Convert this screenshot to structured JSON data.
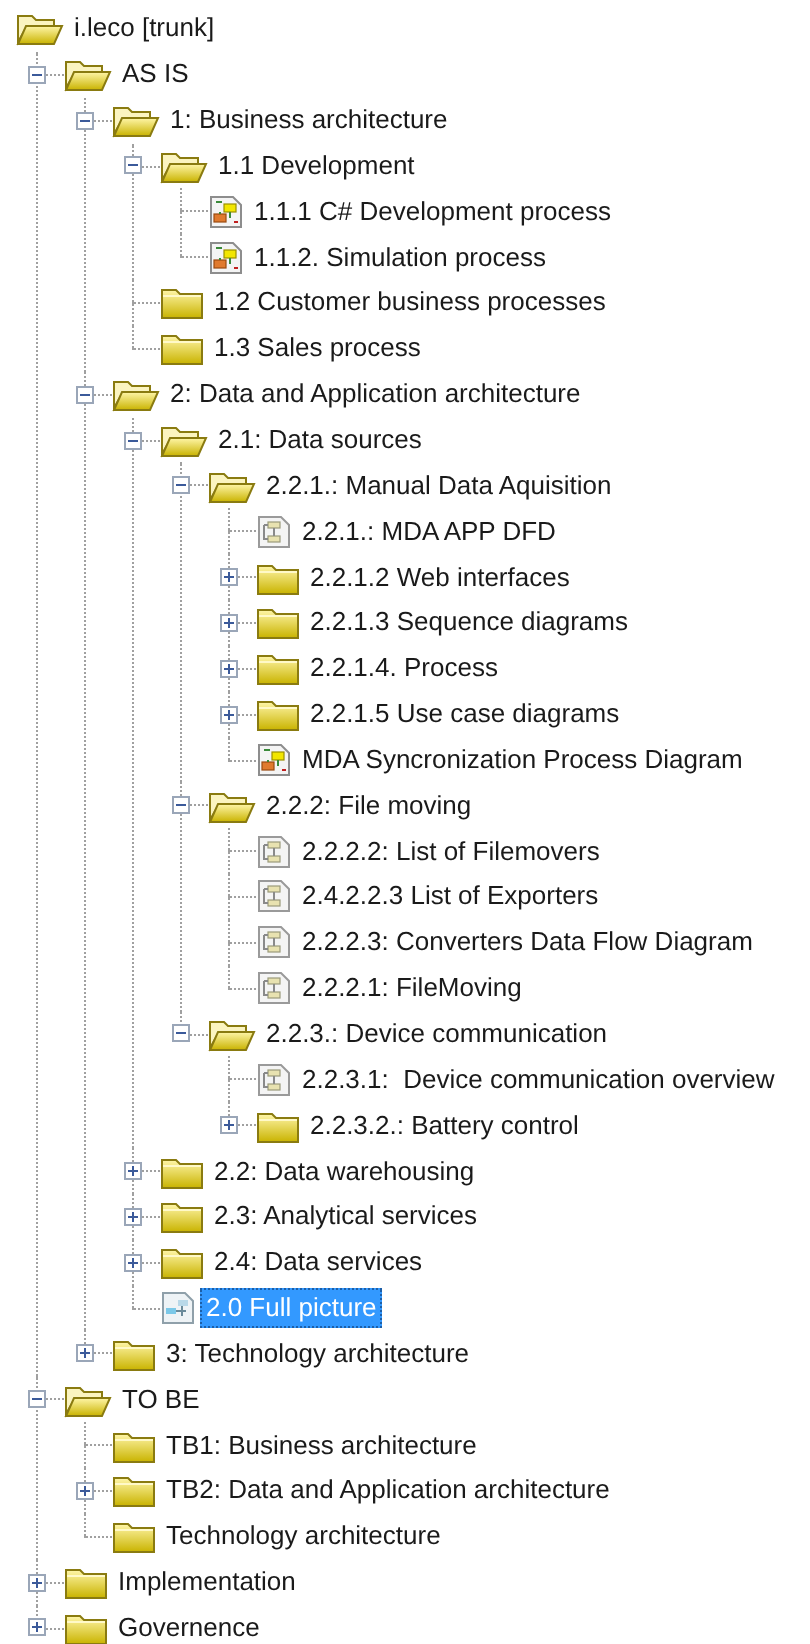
{
  "root": {
    "label": "i.leco [trunk]",
    "selected": false,
    "children": [
      {
        "label": "AS IS",
        "kind": "folder",
        "expanded": true,
        "selected": false,
        "children": [
          {
            "label": "1: Business architecture",
            "kind": "folder",
            "expanded": true,
            "selected": false,
            "children": [
              {
                "label": "1.1 Development",
                "kind": "folder",
                "expanded": true,
                "selected": false,
                "children": [
                  {
                    "label": "1.1.1 C# Development process",
                    "kind": "diagram",
                    "selected": false
                  },
                  {
                    "label": "1.1.2. Simulation process",
                    "kind": "diagram",
                    "selected": false
                  }
                ]
              },
              {
                "label": "1.2 Customer business processes",
                "kind": "folder",
                "selected": false
              },
              {
                "label": "1.3 Sales process",
                "kind": "folder",
                "selected": false
              }
            ]
          },
          {
            "label": "2: Data and Application architecture",
            "kind": "folder",
            "expanded": true,
            "selected": false,
            "children": [
              {
                "label": "2.1: Data sources",
                "kind": "folder",
                "expanded": true,
                "selected": false,
                "children": [
                  {
                    "label": "2.2.1.: Manual Data Aquisition",
                    "kind": "folder",
                    "expanded": true,
                    "selected": false,
                    "children": [
                      {
                        "label": "2.2.1.: MDA APP DFD",
                        "kind": "flow",
                        "selected": false
                      },
                      {
                        "label": "2.2.1.2 Web interfaces",
                        "kind": "folder",
                        "expanded": false,
                        "selected": false
                      },
                      {
                        "label": "2.2.1.3 Sequence diagrams",
                        "kind": "folder",
                        "expanded": false,
                        "selected": false
                      },
                      {
                        "label": "2.2.1.4. Process",
                        "kind": "folder",
                        "expanded": false,
                        "selected": false
                      },
                      {
                        "label": "2.2.1.5 Use case diagrams",
                        "kind": "folder",
                        "expanded": false,
                        "selected": false
                      },
                      {
                        "label": "MDA Syncronization Process Diagram",
                        "kind": "diagram",
                        "selected": false
                      }
                    ]
                  },
                  {
                    "label": "2.2.2: File moving",
                    "kind": "folder",
                    "expanded": true,
                    "selected": false,
                    "children": [
                      {
                        "label": "2.2.2.2: List of Filemovers",
                        "kind": "flow",
                        "selected": false
                      },
                      {
                        "label": "2.4.2.2.3 List of Exporters",
                        "kind": "flow",
                        "selected": false
                      },
                      {
                        "label": "2.2.2.3: Converters Data Flow Diagram",
                        "kind": "flow",
                        "selected": false
                      },
                      {
                        "label": "2.2.2.1: FileMoving",
                        "kind": "flow",
                        "selected": false
                      }
                    ]
                  },
                  {
                    "label": "2.2.3.: Device communication",
                    "kind": "folder",
                    "expanded": true,
                    "selected": false,
                    "children": [
                      {
                        "label": "2.2.3.1:  Device communication overview",
                        "kind": "flow",
                        "selected": false
                      },
                      {
                        "label": "2.2.3.2.: Battery control",
                        "kind": "folder",
                        "expanded": false,
                        "selected": false
                      }
                    ]
                  }
                ]
              },
              {
                "label": "2.2: Data warehousing",
                "kind": "folder",
                "expanded": false,
                "selected": false
              },
              {
                "label": "2.3: Analytical services",
                "kind": "folder",
                "expanded": false,
                "selected": false
              },
              {
                "label": "2.4: Data services",
                "kind": "folder",
                "expanded": false,
                "selected": false
              },
              {
                "label": "2.0 Full picture",
                "kind": "overview",
                "selected": true
              }
            ]
          },
          {
            "label": "3: Technology architecture",
            "kind": "folder",
            "expanded": false,
            "selected": false
          }
        ]
      },
      {
        "label": "TO BE",
        "kind": "folder",
        "expanded": true,
        "selected": false,
        "children": [
          {
            "label": "TB1: Business architecture",
            "kind": "folder",
            "selected": false
          },
          {
            "label": "TB2: Data and Application architecture",
            "kind": "folder",
            "expanded": false,
            "selected": false
          },
          {
            "label": "Technology architecture",
            "kind": "folder",
            "selected": false
          }
        ]
      },
      {
        "label": "Implementation",
        "kind": "folder",
        "expanded": false,
        "selected": false
      },
      {
        "label": "Governence",
        "kind": "folder",
        "expanded": false,
        "selected": false
      }
    ]
  }
}
